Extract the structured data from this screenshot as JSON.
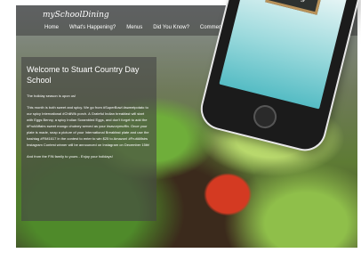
{
  "header": {
    "logo": "mySchoolDining",
    "nav": [
      "Home",
      "What's Happening?",
      "Menus",
      "Did You Know?",
      "Comments"
    ]
  },
  "welcome": {
    "title": "Welcome to Stuart Country Day School",
    "paragraphs": [
      "The holiday season is upon us!",
      "This month is both sweet and spicy. We go from #SuperBowl #sweetpotato to our spicy International #ChiliWk porch. A Grateful Indian breakfast will start with Eggs Benny, a spicy Indian Scrambled Eggs, and don't forget to add the #FruitAffairs sweet mango chutney served as your #savorymuffin. Once your plate is made, snap a picture of your International Breakfast plate and use the hashtag #FIM1617 in the contest to enter to win $25 to Amazon! #FruitAffairs Instagram Contest winner will be announced on Instagram on December 15th!",
      "And from the FIN family to yours - Enjoy your holidays!"
    ]
  },
  "phone": {
    "sign": "mySchool Dining"
  },
  "colors": {
    "nav_bg": "#3c3c3c",
    "panel_bg": "#464646",
    "phone_screen": "#9ad9dc",
    "chalkboard": "#2e3230"
  }
}
